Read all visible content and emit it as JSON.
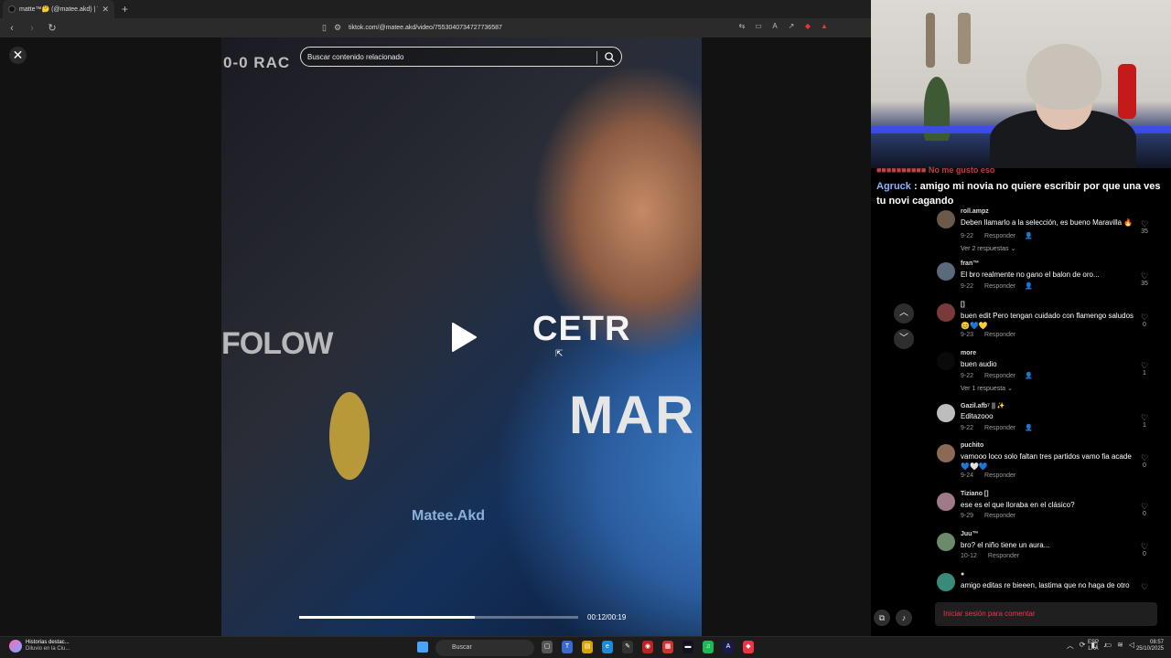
{
  "browser": {
    "tab_title": "matte™🤔 (@matee.akd) | TikTok",
    "tab_close": "✕",
    "new_tab": "+",
    "url": "tiktok.com/@matee.akd/video/7553040734727736587"
  },
  "player": {
    "search_placeholder": "Buscar contenido relacionado",
    "time": "00:12/00:19",
    "progress": 0.63,
    "close_label": "✕",
    "video_text": {
      "score": "0-0  RAC",
      "follow": "FOLOW",
      "sponsor": "CETR",
      "name": "MAR",
      "watermark": "Matee.Akd"
    }
  },
  "chat": {
    "previous": "■■■■■■■■■■ No me gusto eso",
    "user": "Agruck",
    "message": " : amigo mi novia no quiere escribir por que una ves tu novi cagando"
  },
  "comments": [
    {
      "user": "roll.ampz",
      "text": "Deben llamarlo a la selección, es bueno Maravilla 🔥",
      "date": "9-22",
      "reply": "Responder",
      "author_liked": "👤",
      "likes": "35",
      "view_replies": "Ver 2 respuestas ⌄"
    },
    {
      "user": "fran™",
      "text": "El bro realmente no gano el balon de oro...",
      "date": "9-22",
      "reply": "Responder",
      "author_liked": "👤",
      "likes": "35",
      "view_replies": ""
    },
    {
      "user": "[]",
      "text": "buen edit Pero tengan cuidado con flamengo saludos 😊💙💛",
      "date": "9-23",
      "reply": "Responder",
      "author_liked": "",
      "likes": "0",
      "view_replies": ""
    },
    {
      "user": "more",
      "text": "buen audio",
      "date": "9-22",
      "reply": "Responder",
      "author_liked": "👤",
      "likes": "1",
      "view_replies": "Ver 1 respuesta ⌄"
    },
    {
      "user": "Gazil.afb⁷ || ✨",
      "text": "Editazooo",
      "date": "9-22",
      "reply": "Responder",
      "author_liked": "👤",
      "likes": "1",
      "view_replies": ""
    },
    {
      "user": "puchito",
      "text": "vamooo loco solo faltan tres partidos vamo fia acade💙🤍💙",
      "date": "9-24",
      "reply": "Responder",
      "author_liked": "",
      "likes": "0",
      "view_replies": ""
    },
    {
      "user": "Tiziano []",
      "text": "ese es el que lloraba en el clásico?",
      "date": "9-29",
      "reply": "Responder",
      "author_liked": "",
      "likes": "0",
      "view_replies": ""
    },
    {
      "user": "Juu™",
      "text": "bro? el niño tiene un aura...",
      "date": "10-12",
      "reply": "Responder",
      "author_liked": "",
      "likes": "0",
      "view_replies": ""
    },
    {
      "user": "●",
      "text": "amigo editas re bieeen, lastima que no haga de otro",
      "date": "",
      "reply": "",
      "author_liked": "",
      "likes": "",
      "view_replies": ""
    }
  ],
  "login_prompt": "Iniciar sesión para comentar",
  "taskbar": {
    "news_title": "Historias destac...",
    "news_sub": "Diluvio en la Ciu...",
    "search": "Buscar",
    "lang1": "ESP",
    "lang2": "LAA",
    "time": "08:57",
    "date": "25/10/2025"
  },
  "colors": {
    "tiktok_red": "#fe2c55",
    "chat_user": "#8ab4ff"
  }
}
